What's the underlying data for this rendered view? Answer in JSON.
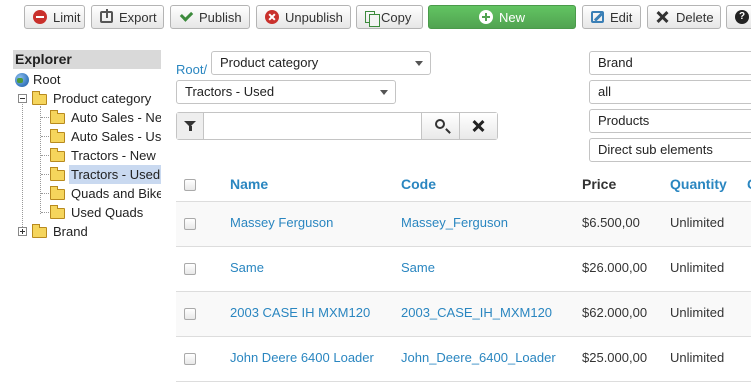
{
  "toolbar": {
    "limit": "Limit",
    "export": "Export",
    "publish": "Publish",
    "unpublish": "Unpublish",
    "copy": "Copy",
    "new": "New",
    "edit": "Edit",
    "delete": "Delete",
    "help": "?"
  },
  "explorer": {
    "title": "Explorer",
    "root": "Root",
    "product_category": "Product category",
    "children": [
      "Auto Sales - Ne",
      "Auto Sales - Use",
      "Tractors - New",
      "Tractors - Used",
      "Quads and Bike",
      "Used Quads"
    ],
    "brand": "Brand",
    "selected": "Tractors - Used"
  },
  "filters": {
    "root_link": "Root/",
    "category_select": "Product category",
    "subcategory_select": "Tractors - Used",
    "search_placeholder": "",
    "right_selects": [
      "Brand",
      "all",
      "Products",
      "Direct sub elements"
    ]
  },
  "table": {
    "headers": {
      "name": "Name",
      "code": "Code",
      "price": "Price",
      "quantity": "Quantity",
      "extra": "C"
    },
    "rows": [
      {
        "name": "Massey Ferguson",
        "code": "Massey_Ferguson",
        "price": "$6.500,00",
        "quantity": "Unlimited"
      },
      {
        "name": "Same",
        "code": "Same",
        "price": "$26.000,00",
        "quantity": "Unlimited"
      },
      {
        "name": "2003 CASE IH MXM120",
        "code": "2003_CASE_IH_MXM120",
        "price": "$62.000,00",
        "quantity": "Unlimited"
      },
      {
        "name": "John Deere 6400 Loader",
        "code": "John_Deere_6400_Loader",
        "price": "$25.000,00",
        "quantity": "Unlimited"
      }
    ]
  },
  "colors": {
    "link": "#2a86c0",
    "new_button": "#51a351",
    "danger_icon": "#c9302c",
    "selected_node": "#c9d9f0"
  },
  "icons": [
    "limit-icon",
    "export-icon",
    "check-icon",
    "unpublish-icon",
    "copy-icon",
    "plus-circle-icon",
    "edit-icon",
    "delete-icon",
    "help-icon",
    "globe-icon",
    "folder-icon",
    "filter-icon",
    "search-icon",
    "close-icon"
  ]
}
